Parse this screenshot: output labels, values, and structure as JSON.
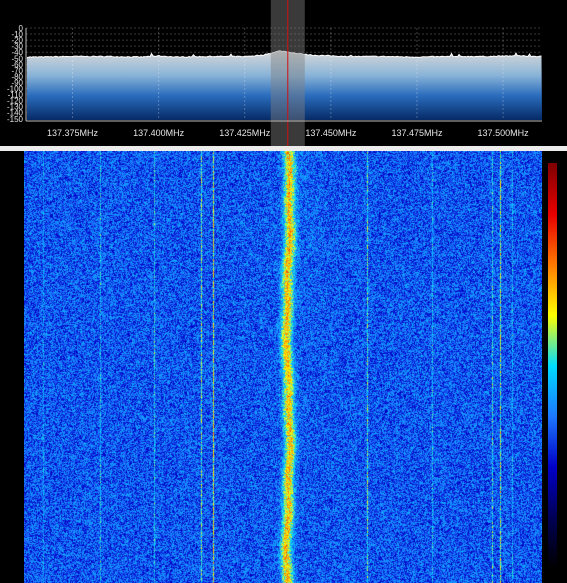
{
  "app": {
    "name": "SDR spectrum analyzer and waterfall",
    "theme": {
      "background": "#000000",
      "text": "#e6e6e6",
      "spectrum_fill_top": "#d8d8d8",
      "spectrum_fill_mid": "#4a8cd0",
      "spectrum_fill_bottom": "#062a66",
      "trace": "#ffffff",
      "tuner_band": "#808080",
      "tuner_line": "#d01010",
      "divider": "#ececec"
    }
  },
  "spectrum": {
    "db_ticks": [
      "0",
      "-10",
      "-20",
      "-30",
      "-40",
      "-50",
      "-60",
      "-70",
      "-80",
      "-90",
      "-100",
      "-110",
      "-120",
      "-130",
      "-140",
      "-150"
    ],
    "freq_ticks": [
      "137.375MHz",
      "137.400MHz",
      "137.425MHz",
      "137.450MHz",
      "137.475MHz",
      "137.500MHz"
    ],
    "tuned_frequency_mhz": 137.4375
  },
  "chart_data": {
    "type": "area",
    "title": "",
    "xlabel": "",
    "ylabel": "",
    "x_unit": "MHz",
    "xlim": [
      137.3615,
      137.5113
    ],
    "ylim": [
      -152,
      0
    ],
    "series": [
      {
        "x": [
          137.365,
          137.375,
          137.385,
          137.395,
          137.4,
          137.405,
          137.415,
          137.425,
          137.43,
          137.433,
          137.435,
          137.437,
          137.44,
          137.445,
          137.455,
          137.465,
          137.475,
          137.485,
          137.495,
          137.505,
          137.51
        ],
        "values": [
          -48,
          -47,
          -47,
          -48,
          -46,
          -48,
          -47,
          -47,
          -45,
          -41,
          -38,
          -39,
          -42,
          -45,
          -47,
          -47,
          -48,
          -47,
          -47,
          -46,
          -47
        ]
      }
    ],
    "grid": true
  },
  "waterfall": {
    "colormap": [
      "#000000",
      "#000055",
      "#0000c8",
      "#1e78ff",
      "#00dcff",
      "#ffff00",
      "#ff7a00",
      "#e80000",
      "#800000"
    ],
    "signal_center_mhz": 137.4375
  }
}
